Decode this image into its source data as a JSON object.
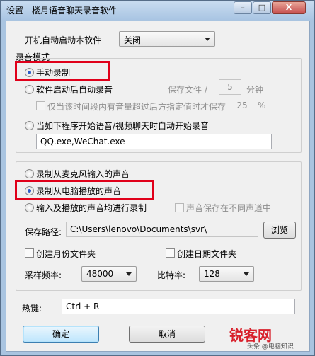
{
  "window": {
    "title": "设置 - 楼月语音聊天录音软件",
    "controls": {
      "minimize": "–",
      "maximize": "□",
      "close": "X"
    }
  },
  "startup": {
    "label": "开机自动启动本软件",
    "value": "关闭"
  },
  "recording_mode": {
    "group_label": "录音模式",
    "manual": "手动录制",
    "auto_on_start": "软件启动后自动录音",
    "save_file_label": "保存文件 /",
    "save_file_minutes": "5",
    "minutes_unit": "分钟",
    "only_save_label": "仅当该时间段内有音量超过后方指定值时才保存",
    "volume_threshold": "25",
    "percent_unit": "%",
    "auto_on_chat": "当如下程序开始语音/视频聊天时自动开始录音",
    "programs": "QQ.exe,WeChat.exe"
  },
  "source": {
    "mic": "录制从麦克风输入的声音",
    "speaker": "录制从电脑播放的声音",
    "both": "输入及播放的声音均进行录制",
    "separate_channels": "声音保存在不同声道中"
  },
  "save_path": {
    "label": "保存路径:",
    "value": "C:\\Users\\lenovo\\Documents\\svr\\",
    "browse": "浏览"
  },
  "folders": {
    "monthly": "创建月份文件夹",
    "daily": "创建日期文件夹"
  },
  "sample_rate": {
    "label": "采样频率:",
    "value": "48000"
  },
  "bit_rate": {
    "label": "比特率:",
    "value": "128"
  },
  "hotkey": {
    "label": "热键:",
    "value": "Ctrl + R"
  },
  "buttons": {
    "ok": "确定",
    "cancel": "取消"
  },
  "watermark": {
    "brand": "锐客网",
    "sub": "头条 @电脑知识"
  },
  "colors": {
    "highlight": "#e0001a",
    "selected_radio": "#2a5bc7"
  }
}
